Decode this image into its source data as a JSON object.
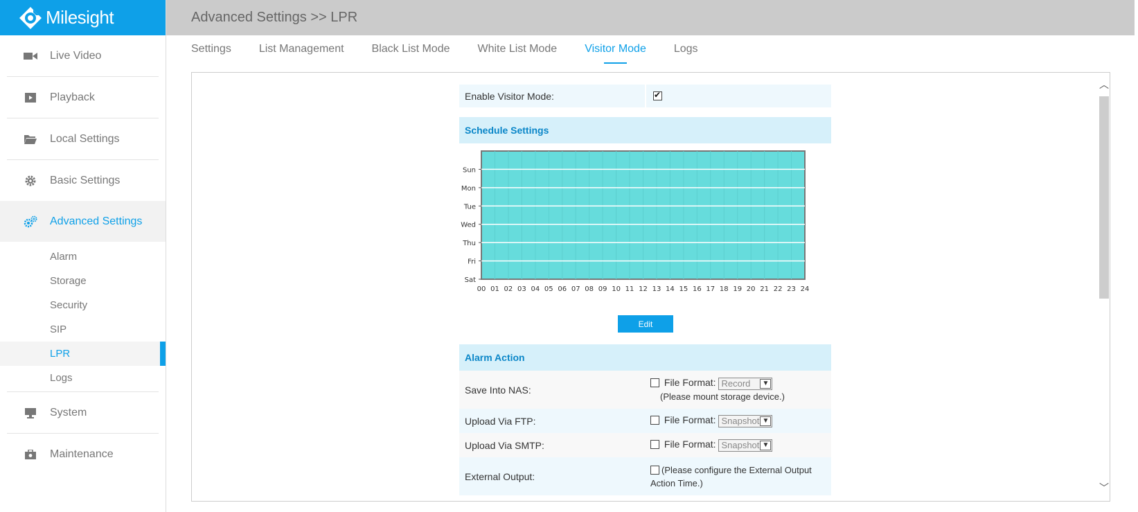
{
  "brand": {
    "name": "Milesight"
  },
  "header": {
    "title": "Advanced Settings >> LPR"
  },
  "sidebar": {
    "items": [
      {
        "label": "Live Video",
        "icon": "video-camera-icon"
      },
      {
        "label": "Playback",
        "icon": "play-icon"
      },
      {
        "label": "Local Settings",
        "icon": "folder-icon"
      },
      {
        "label": "Basic Settings",
        "icon": "gear-icon"
      },
      {
        "label": "Advanced Settings",
        "icon": "gears-icon"
      }
    ],
    "sub_items": [
      "Alarm",
      "Storage",
      "Security",
      "SIP",
      "LPR",
      "Logs"
    ],
    "bottom_items": [
      {
        "label": "System",
        "icon": "monitor-icon"
      },
      {
        "label": "Maintenance",
        "icon": "toolbox-icon"
      }
    ]
  },
  "tabs": [
    "Settings",
    "List Management",
    "Black List Mode",
    "White List Mode",
    "Visitor Mode",
    "Logs"
  ],
  "active_tab": "Visitor Mode",
  "form": {
    "enable_label": "Enable Visitor Mode:",
    "enable_checked": true,
    "schedule_title": "Schedule Settings",
    "days": [
      "Sun",
      "Mon",
      "Tue",
      "Wed",
      "Thu",
      "Fri",
      "Sat"
    ],
    "hours": [
      "00",
      "01",
      "02",
      "03",
      "04",
      "05",
      "06",
      "07",
      "08",
      "09",
      "10",
      "11",
      "12",
      "13",
      "14",
      "15",
      "16",
      "17",
      "18",
      "19",
      "20",
      "21",
      "22",
      "23",
      "24"
    ],
    "edit_label": "Edit",
    "alarm_title": "Alarm Action",
    "nas_label": "Save Into NAS:",
    "file_format_label": "File Format:",
    "nas_format": "Record",
    "nas_note": "(Please mount storage device.)",
    "ftp_label": "Upload Via FTP:",
    "ftp_format": "Snapshot",
    "smtp_label": "Upload Via SMTP:",
    "smtp_format": "Snapshot",
    "ext_label": "External Output:",
    "ext_note": "(Please configure the External Output Action Time.)"
  },
  "colors": {
    "accent": "#0ea0e8",
    "schedule_fill": "#66dcdc",
    "header_bg": "#cbcbcb"
  }
}
